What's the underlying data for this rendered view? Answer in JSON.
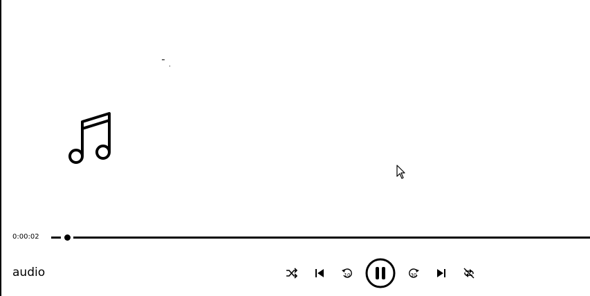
{
  "player": {
    "elapsed": "0:00:02",
    "title": "audio",
    "progress_fraction": 0.03,
    "state": "playing"
  },
  "icons": {
    "art": "music-note-icon",
    "shuffle": "shuffle-icon",
    "previous": "skip-previous-icon",
    "skip_back": "skip-back-10-icon",
    "skip_back_label": "10",
    "play_pause": "pause-icon",
    "skip_forward": "skip-forward-30-icon",
    "skip_forward_label": "30",
    "next": "skip-next-icon",
    "repeat": "repeat-off-icon"
  },
  "colors": {
    "foreground": "#000000",
    "background": "#ffffff"
  }
}
